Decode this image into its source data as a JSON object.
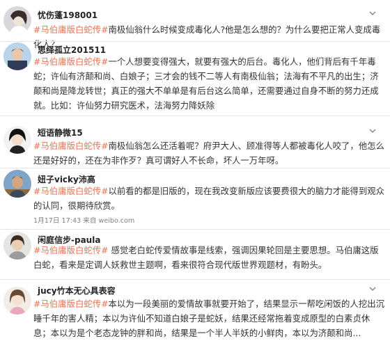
{
  "posts": [
    {
      "username": "忧伤蓬198001",
      "tag": "#马伯庸版白蛇传#",
      "text": "南极仙翁什么时候变成毒化人?他是怎么想的？为什么要把正常人变成毒化人？",
      "meta": ""
    },
    {
      "username": "思绎孤立201511",
      "tag": "#马伯庸版白蛇传#",
      "text": "一个人想要变得强大，就要有强大的后台。毒化人，他们背后有千年毒蛇；许仙有济颠和尚、白娘子；三才会的钱不二等人有南极仙翁；法海有不平凡的出生；济颠和尚是降龙转世；真正的强大不单单是有后台这么简单，还需要通过自身不断的努力还成就。比如：许仙努力研究医术，法海努力降妖除",
      "meta": ""
    },
    {
      "username": "短语静微15",
      "tag": "#马伯庸版白蛇传#",
      "text": "南极仙翁怎么还活着呢？府尹大人、顾准得等人都被毒化人咬了，他怎么还是好好的，还在为非作歹？真可谓好人不长命，坏人一万年呀。",
      "meta": ""
    },
    {
      "username": "妞子vicky沛高",
      "tag": "#马伯庸版白蛇传#",
      "text": "以前看的都是旧版的，现在我改变新版应该要费很大的脑力才能得到观众的认同，很期待欣赏。",
      "meta": "1月17日 17:43 来自 weibo.com"
    },
    {
      "username": "闲庭信步-paula",
      "tag": "#马伯庸版白蛇传#",
      "text": " 感觉老白蛇传爱情故事是线索，强调因果轮回是主要思想。马伯庸这版白蛇，看来是定调人妖救世主题啊，看来很符合现代版世界观题材，有盼头。",
      "meta": ""
    },
    {
      "username": "jucy竹本无心具表容",
      "tag": "#马伯庸版白蛇传#",
      "text": "本以为一段美丽的爱情故事就要开始了，结果显示一帮吃闲饭的人挖出沉睡千年的害人精；本以为许仙不知道白娘子是蛇妖，结果还经常拖着变成原型的白素贞休息；本以为是个老态龙钟的胖和尚，结果是一个半人半妖的小鲜肉，本以为济颠和尚...",
      "meta": ""
    }
  ],
  "colors": {
    "tag": "#eb7350",
    "meta": "#808080",
    "divider": "#e6e6e6",
    "text": "#333333"
  },
  "icons": {
    "menu": "chevron-down-icon",
    "avatar": "avatar"
  }
}
